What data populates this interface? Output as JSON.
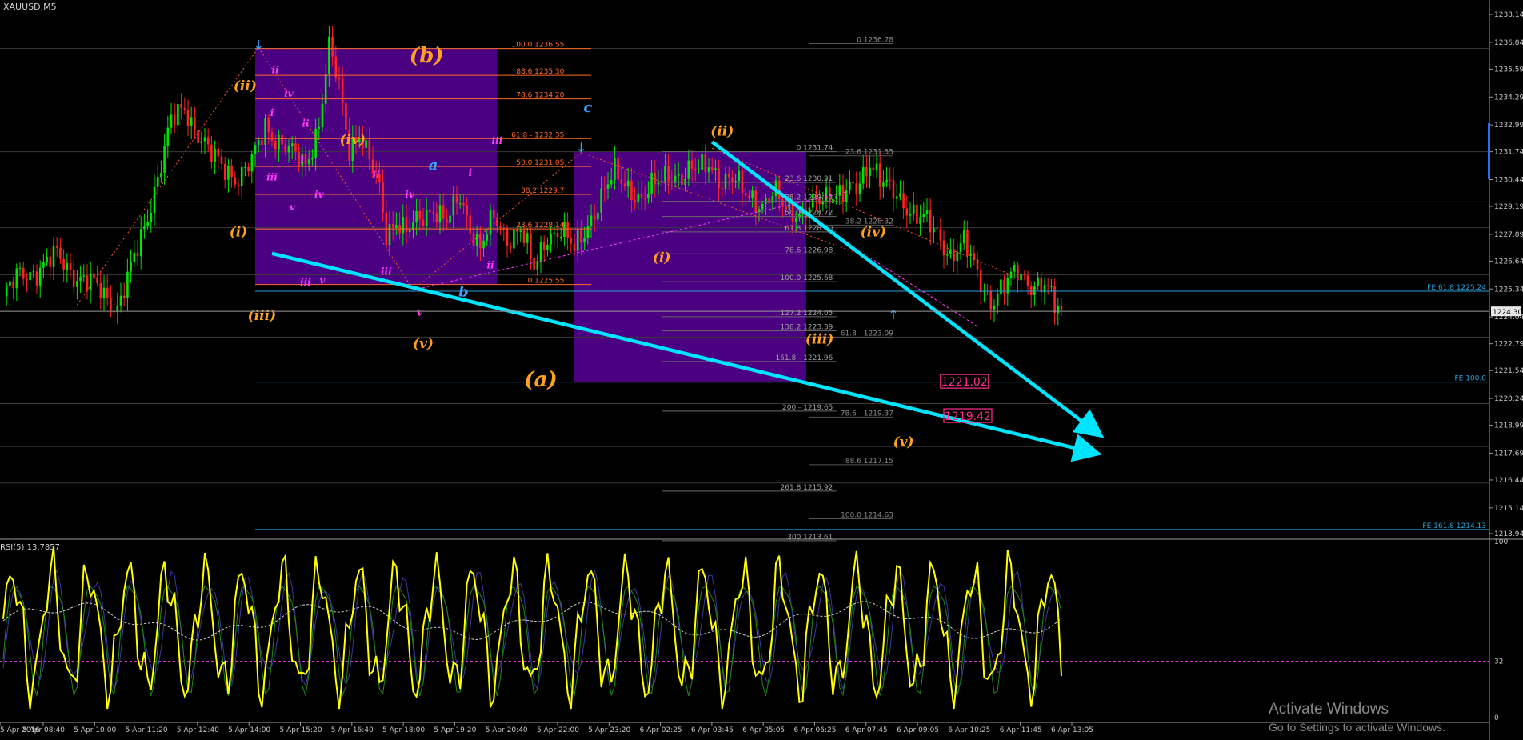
{
  "header": {
    "symbol": "XAUUSD,M5"
  },
  "indicator": {
    "label": "RSI(5) 13.7857",
    "levels": [
      "100",
      "32",
      "0"
    ]
  },
  "watermark": {
    "title": "Activate Windows",
    "subtitle": "Go to Settings to activate Windows."
  },
  "colors": {
    "background": "#000000",
    "bull": "#00e600",
    "bear": "#ff2222",
    "zone": "#4b0082",
    "trend": "#00e5ff",
    "wave_orange": "#ffa020",
    "wave_magenta": "#ff3bff",
    "wave_blue": "#3aa0ff",
    "rsi": "#ffff00",
    "target_box": "#ff2e8c",
    "fib_red": "#ff6a2a",
    "fib_gray": "#8a8a8a",
    "fe_line": "#2aa0d8"
  },
  "chart_data": {
    "type": "candlestick",
    "symbol": "XAUUSD",
    "timeframe": "M5",
    "ylim": [
      1213.94,
      1238.14
    ],
    "price_ticks": [
      "1238.14",
      "1236.84",
      "1235.59",
      "1234.29",
      "1232.99",
      "1231.74",
      "1230.44",
      "1229.19",
      "1227.89",
      "1226.64",
      "1225.34",
      "1224.04",
      "1222.79",
      "1221.54",
      "1220.24",
      "1218.99",
      "1217.69",
      "1216.44",
      "1215.14",
      "1213.94"
    ],
    "current_price": "1224.30",
    "time_ticks": [
      "5 Apr 2016",
      "5 Apr 08:40",
      "5 Apr 10:00",
      "5 Apr 11:20",
      "5 Apr 12:40",
      "5 Apr 14:00",
      "5 Apr 15:20",
      "5 Apr 16:40",
      "5 Apr 18:00",
      "5 Apr 19:20",
      "5 Apr 20:40",
      "5 Apr 22:00",
      "5 Apr 23:20",
      "6 Apr 02:25",
      "6 Apr 03:45",
      "6 Apr 05:05",
      "6 Apr 06:25",
      "6 Apr 07:45",
      "6 Apr 09:05",
      "6 Apr 10:25",
      "6 Apr 11:45",
      "6 Apr 13:05"
    ],
    "close_path": [
      {
        "i": 0,
        "p": 1225.0
      },
      {
        "i": 5,
        "p": 1226.0
      },
      {
        "i": 10,
        "p": 1226.2
      },
      {
        "i": 16,
        "p": 1226.9
      },
      {
        "i": 22,
        "p": 1225.9
      },
      {
        "i": 28,
        "p": 1225.4
      },
      {
        "i": 34,
        "p": 1224.5
      },
      {
        "i": 38,
        "p": 1226.2
      },
      {
        "i": 42,
        "p": 1228.2
      },
      {
        "i": 46,
        "p": 1230.6
      },
      {
        "i": 50,
        "p": 1233.1
      },
      {
        "i": 54,
        "p": 1233.8
      },
      {
        "i": 58,
        "p": 1232.6
      },
      {
        "i": 62,
        "p": 1231.5
      },
      {
        "i": 66,
        "p": 1231.0
      },
      {
        "i": 70,
        "p": 1230.5
      },
      {
        "i": 74,
        "p": 1231.2
      },
      {
        "i": 78,
        "p": 1233.0
      },
      {
        "i": 82,
        "p": 1232.2
      },
      {
        "i": 86,
        "p": 1231.6
      },
      {
        "i": 90,
        "p": 1231.2
      },
      {
        "i": 94,
        "p": 1233.0
      },
      {
        "i": 97,
        "p": 1236.5
      },
      {
        "i": 100,
        "p": 1234.8
      },
      {
        "i": 103,
        "p": 1232.0
      },
      {
        "i": 106,
        "p": 1232.6
      },
      {
        "i": 109,
        "p": 1231.2
      },
      {
        "i": 112,
        "p": 1230.0
      },
      {
        "i": 114,
        "p": 1228.0
      },
      {
        "i": 117,
        "p": 1228.6
      },
      {
        "i": 120,
        "p": 1227.9
      },
      {
        "i": 124,
        "p": 1228.6
      },
      {
        "i": 128,
        "p": 1229.2
      },
      {
        "i": 132,
        "p": 1228.4
      },
      {
        "i": 136,
        "p": 1229.6
      },
      {
        "i": 139,
        "p": 1228.3
      },
      {
        "i": 142,
        "p": 1227.3
      },
      {
        "i": 146,
        "p": 1228.6
      },
      {
        "i": 150,
        "p": 1227.7
      },
      {
        "i": 154,
        "p": 1228.2
      },
      {
        "i": 158,
        "p": 1226.2
      },
      {
        "i": 162,
        "p": 1227.9
      },
      {
        "i": 166,
        "p": 1228.1
      },
      {
        "i": 170,
        "p": 1227.1
      },
      {
        "i": 174,
        "p": 1228.4
      },
      {
        "i": 178,
        "p": 1229.6
      },
      {
        "i": 182,
        "p": 1230.7
      },
      {
        "i": 186,
        "p": 1230.2
      },
      {
        "i": 190,
        "p": 1229.4
      },
      {
        "i": 194,
        "p": 1230.2
      },
      {
        "i": 198,
        "p": 1230.9
      },
      {
        "i": 202,
        "p": 1230.4
      },
      {
        "i": 206,
        "p": 1230.9
      },
      {
        "i": 210,
        "p": 1231.4
      },
      {
        "i": 214,
        "p": 1230.1
      },
      {
        "i": 218,
        "p": 1230.4
      },
      {
        "i": 222,
        "p": 1229.9
      },
      {
        "i": 226,
        "p": 1229.0
      },
      {
        "i": 230,
        "p": 1229.8
      },
      {
        "i": 234,
        "p": 1229.2
      },
      {
        "i": 238,
        "p": 1228.6
      },
      {
        "i": 242,
        "p": 1229.4
      },
      {
        "i": 246,
        "p": 1229.9
      },
      {
        "i": 250,
        "p": 1229.7
      },
      {
        "i": 254,
        "p": 1230.0
      },
      {
        "i": 258,
        "p": 1231.4
      },
      {
        "i": 262,
        "p": 1230.2
      },
      {
        "i": 266,
        "p": 1229.6
      },
      {
        "i": 270,
        "p": 1229.1
      },
      {
        "i": 274,
        "p": 1228.6
      },
      {
        "i": 278,
        "p": 1227.8
      },
      {
        "i": 282,
        "p": 1227.0
      },
      {
        "i": 286,
        "p": 1227.5
      },
      {
        "i": 290,
        "p": 1226.0
      },
      {
        "i": 294,
        "p": 1224.8
      },
      {
        "i": 298,
        "p": 1225.4
      },
      {
        "i": 302,
        "p": 1226.2
      },
      {
        "i": 306,
        "p": 1225.6
      },
      {
        "i": 310,
        "p": 1225.4
      },
      {
        "i": 313,
        "p": 1224.6
      },
      {
        "i": 315,
        "p": 1224.3
      }
    ],
    "fib_retracement_left": [
      {
        "level": "100.0",
        "price": 1236.55
      },
      {
        "level": "88.6",
        "price": 1235.3
      },
      {
        "level": "78.6",
        "price": 1234.2
      },
      {
        "level": "61.8",
        "price": 1232.35
      },
      {
        "level": "50.0",
        "price": 1231.05
      },
      {
        "level": "38.2",
        "price": 1229.75
      },
      {
        "level": "23.6",
        "price": 1228.14
      },
      {
        "level": "0",
        "price": 1225.55
      }
    ],
    "fib_left_labels": [
      "100.0 1236.55",
      "88.6 1235.30",
      "78.6 1234.20",
      "61.8 - 1232.35",
      "50.0 1231.05",
      "38.2 1229.7",
      "23.6 1228.14",
      "0 1225.55"
    ],
    "fib_right_labels": [
      {
        "text": "0 1236.78",
        "price": 1236.78
      },
      {
        "text": "23.6 1231.55",
        "price": 1231.55
      },
      {
        "text": "38.2 1228.32",
        "price": 1228.32
      },
      {
        "text": "61.8 - 1223.09",
        "price": 1223.09
      },
      {
        "text": "78.6 - 1219.37",
        "price": 1219.37
      },
      {
        "text": "88.6 1217.15",
        "price": 1217.15
      },
      {
        "text": "100.0 1214.63",
        "price": 1214.63
      }
    ],
    "fib_mid_labels": [
      {
        "text": "0 1231.74",
        "price": 1231.74
      },
      {
        "text": "23.6 1230.31",
        "price": 1230.31
      },
      {
        "text": "38.2 1229.43",
        "price": 1229.43
      },
      {
        "text": "50.0 1228.72",
        "price": 1228.72
      },
      {
        "text": "61.8 1228.00",
        "price": 1228.0
      },
      {
        "text": "78.6 1226.98",
        "price": 1226.98
      },
      {
        "text": "100.0 1225.68",
        "price": 1225.68
      },
      {
        "text": "127.2 1224.05",
        "price": 1224.05
      },
      {
        "text": "138.2 1223.39",
        "price": 1223.39
      },
      {
        "text": "161.8 - 1221.96",
        "price": 1221.96
      },
      {
        "text": "200 - 1219.65",
        "price": 1219.65
      },
      {
        "text": "261.8 1215.92",
        "price": 1215.92
      },
      {
        "text": "300 1213.61",
        "price": 1213.61
      }
    ],
    "fe_lines": [
      {
        "text": "FE 61.8 1225.24",
        "price": 1225.24
      },
      {
        "text": "FE 100.0",
        "price": 1221.0
      },
      {
        "text": "FE 161.8 1214.13",
        "price": 1214.13
      }
    ],
    "targets": [
      "1221.02",
      "1219.42"
    ],
    "wave_labels": [
      {
        "text": "(b)",
        "price": 1235.9,
        "i": 126,
        "color": "wave_orange",
        "size": 26
      },
      {
        "text": "(a)",
        "price": 1220.8,
        "i": 160,
        "color": "wave_orange",
        "size": 26
      },
      {
        "text": "(ii)",
        "price": 1234.6,
        "i": 72,
        "color": "wave_orange",
        "size": 17
      },
      {
        "text": "(iv)",
        "price": 1232.1,
        "i": 104,
        "color": "wave_orange",
        "size": 17
      },
      {
        "text": "(i)",
        "price": 1227.8,
        "i": 70,
        "color": "wave_orange",
        "size": 17
      },
      {
        "text": "(iii)",
        "price": 1223.9,
        "i": 77,
        "color": "wave_orange",
        "size": 17
      },
      {
        "text": "(v)",
        "price": 1222.6,
        "i": 125,
        "color": "wave_orange",
        "size": 17
      },
      {
        "text": "(i)",
        "price": 1226.6,
        "i": 196,
        "color": "wave_orange",
        "size": 17
      },
      {
        "text": "(ii)",
        "price": 1232.5,
        "i": 214,
        "color": "wave_orange",
        "size": 17
      },
      {
        "text": "(iii)",
        "price": 1222.8,
        "i": 243,
        "color": "wave_orange",
        "size": 17
      },
      {
        "text": "(iv)",
        "price": 1227.8,
        "i": 259,
        "color": "wave_orange",
        "size": 17
      },
      {
        "text": "(v)",
        "price": 1218.0,
        "i": 268,
        "color": "wave_orange",
        "size": 17
      },
      {
        "text": "a",
        "price": 1230.9,
        "i": 128,
        "color": "wave_blue",
        "size": 18
      },
      {
        "text": "b",
        "price": 1225.0,
        "i": 137,
        "color": "wave_blue",
        "size": 18
      },
      {
        "text": "c",
        "price": 1233.6,
        "i": 174,
        "color": "wave_blue",
        "size": 18
      },
      {
        "text": "i",
        "price": 1233.4,
        "i": 80,
        "color": "wave_magenta",
        "size": 12
      },
      {
        "text": "ii",
        "price": 1235.4,
        "i": 81,
        "color": "wave_magenta",
        "size": 12
      },
      {
        "text": "iv",
        "price": 1234.3,
        "i": 85,
        "color": "wave_magenta",
        "size": 12
      },
      {
        "text": "ii",
        "price": 1232.9,
        "i": 90,
        "color": "wave_magenta",
        "size": 12
      },
      {
        "text": "i",
        "price": 1231.2,
        "i": 89,
        "color": "wave_magenta",
        "size": 12
      },
      {
        "text": "iii",
        "price": 1230.4,
        "i": 80,
        "color": "wave_magenta",
        "size": 12
      },
      {
        "text": "v",
        "price": 1229.0,
        "i": 86,
        "color": "wave_magenta",
        "size": 12
      },
      {
        "text": "iv",
        "price": 1229.6,
        "i": 94,
        "color": "wave_magenta",
        "size": 12
      },
      {
        "text": "iii",
        "price": 1225.5,
        "i": 90,
        "color": "wave_magenta",
        "size": 12
      },
      {
        "text": "v",
        "price": 1225.6,
        "i": 95,
        "color": "wave_magenta",
        "size": 12
      },
      {
        "text": "ii",
        "price": 1230.5,
        "i": 111,
        "color": "wave_magenta",
        "size": 12
      },
      {
        "text": "iv",
        "price": 1229.6,
        "i": 121,
        "color": "wave_magenta",
        "size": 12
      },
      {
        "text": "iii",
        "price": 1226.0,
        "i": 114,
        "color": "wave_magenta",
        "size": 12
      },
      {
        "text": "v",
        "price": 1224.1,
        "i": 124,
        "color": "wave_magenta",
        "size": 12
      },
      {
        "text": "i",
        "price": 1230.6,
        "i": 139,
        "color": "wave_magenta",
        "size": 12
      },
      {
        "text": "ii",
        "price": 1226.3,
        "i": 145,
        "color": "wave_magenta",
        "size": 12
      },
      {
        "text": "iii",
        "price": 1232.1,
        "i": 147,
        "color": "wave_magenta",
        "size": 12
      }
    ],
    "trendlines": [
      {
        "from": {
          "i": 80,
          "p": 1227.0
        },
        "to": {
          "i": 325,
          "p": 1217.7
        }
      },
      {
        "from": {
          "i": 211,
          "p": 1232.2
        },
        "to": {
          "i": 326,
          "p": 1218.6
        }
      }
    ],
    "rsi_level": 32,
    "rsi_range": [
      0,
      100
    ]
  }
}
